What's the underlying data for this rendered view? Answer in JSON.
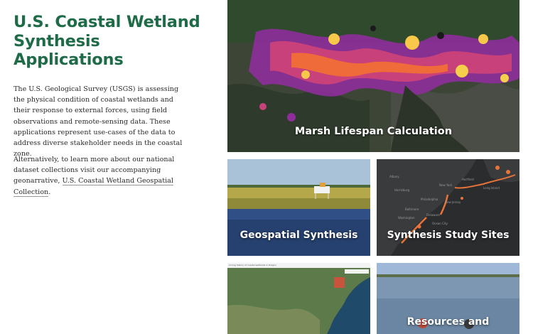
{
  "intro": {
    "title": "U.S. Coastal Wetland Synthesis Applications",
    "paragraph1": "The U.S. Geological Survey (USGS) is assessing the physical condition of coastal wetlands and their response to external forces, using field observations and remote-sensing data. These applications represent use-cases of the data to address diverse stakeholder needs in the coastal zone.",
    "paragraph2_prefix": "Alternatively, to learn more about our national dataset collections visit our accompanying geonarrative, ",
    "paragraph2_link": "U.S. Coastal Wetland Geospatial Collection",
    "paragraph2_suffix": "."
  },
  "cards": {
    "marsh_lifespan": "Marsh Lifespan Calculation",
    "geospatial_synthesis": "Geospatial Synthesis",
    "study_sites": "Synthesis Study Sites",
    "map_caption": "Coring history of coastal wetlands in Oregon",
    "resources": "Resources and"
  },
  "map_places": {
    "labels": [
      "Hartford",
      "New York",
      "Long Island",
      "New Jersey",
      "Philadelphia",
      "Baltimore",
      "Washington",
      "Ocean City",
      "Delaware",
      "Harrisburg",
      "Albany"
    ]
  },
  "colors": {
    "title_green": "#1e6b47",
    "body_text": "#2b2b2b",
    "card_label": "#ffffff"
  }
}
